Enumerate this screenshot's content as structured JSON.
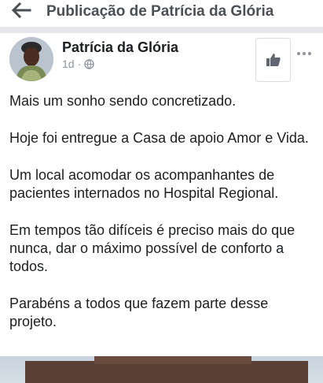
{
  "header": {
    "title": "Publicação de Patrícia da Glória",
    "back_icon": "arrow-left-icon"
  },
  "post": {
    "author": "Patrícia da Glória",
    "time": "1d",
    "visibility_icon": "globe-icon",
    "like_icon": "thumbs-up-icon",
    "more_icon": "more-horizontal-icon",
    "paragraphs": [
      "Mais um sonho sendo concretizado.",
      "Hoje foi entregue a Casa de apoio Amor e Vida.",
      "Um local acomodar os acompanhantes de pacientes internados no Hospital Regional.",
      "Em tempos tão difíceis é preciso mais do que nunca, dar o máximo possível de conforto a todos.",
      "Parabéns a todos que fazem parte desse projeto."
    ]
  },
  "colors": {
    "title_gray": "#4b4f56",
    "meta_gray": "#8d949e",
    "divider": "#e4e6eb"
  }
}
